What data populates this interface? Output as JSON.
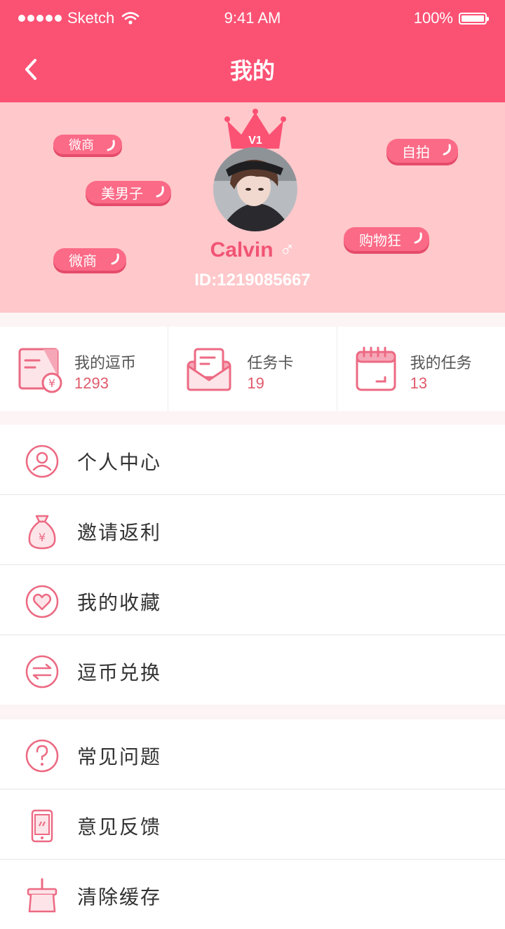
{
  "status_bar": {
    "carrier": "Sketch",
    "time": "9:41 AM",
    "battery": "100%"
  },
  "nav": {
    "title": "我的"
  },
  "profile": {
    "crown_level": "V1",
    "name": "Calvin",
    "gender_symbol": "♂",
    "user_id": "ID:1219085667",
    "tags": [
      "微商",
      "美男子",
      "微商",
      "自拍",
      "购物狂"
    ]
  },
  "stats": [
    {
      "label": "我的逗币",
      "value": "1293",
      "icon": "coin-document-icon"
    },
    {
      "label": "任务卡",
      "value": "19",
      "icon": "envelope-icon"
    },
    {
      "label": "我的任务",
      "value": "13",
      "icon": "calendar-icon"
    }
  ],
  "menu_group1": [
    {
      "label": "个人中心",
      "icon": "person-icon"
    },
    {
      "label": "邀请返利",
      "icon": "money-bag-icon"
    },
    {
      "label": "我的收藏",
      "icon": "heart-icon"
    },
    {
      "label": "逗币兑换",
      "icon": "exchange-arrows-icon"
    }
  ],
  "menu_group2": [
    {
      "label": "常见问题",
      "icon": "question-icon"
    },
    {
      "label": "意见反馈",
      "icon": "phone-feedback-icon"
    },
    {
      "label": "清除缓存",
      "icon": "broom-icon"
    }
  ],
  "colors": {
    "primary": "#fb5274",
    "profile_bg": "#ffc8cb",
    "accent_value": "#e05a6a"
  }
}
